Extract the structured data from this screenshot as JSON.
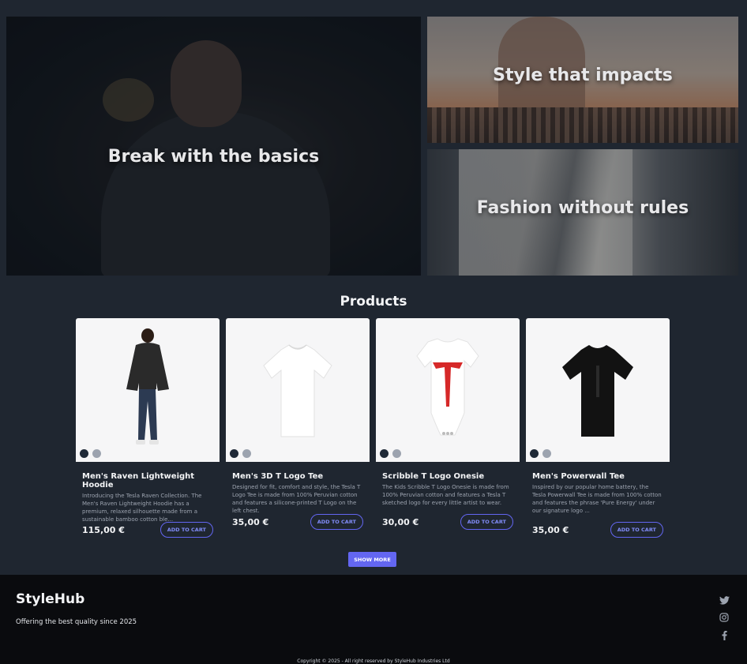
{
  "hero": {
    "main_title": "Break with the basics",
    "top_right_title": "Style that impacts",
    "bottom_right_title": "Fashion without rules"
  },
  "products": {
    "title": "Products",
    "items": [
      {
        "name": "Men's Raven Lightweight Hoodie",
        "description": "Introducing the Tesla Raven Collection. The Men's Raven Lightweight Hoodie has a premium, relaxed silhouette made from a sustainable bamboo cotton ble...",
        "price": "115,00 €",
        "button": "ADD TO CART"
      },
      {
        "name": "Men's 3D T Logo Tee",
        "description": "Designed for fit, comfort and style, the Tesla T Logo Tee is made from 100% Peruvian cotton and features a silicone-printed T Logo on the left chest.",
        "price": "35,00 €",
        "button": "ADD TO CART"
      },
      {
        "name": "Scribble T Logo Onesie",
        "description": "The Kids Scribble T Logo Onesie is made from 100% Peruvian cotton and features a Tesla T sketched logo for every little artist to wear.",
        "price": "30,00 €",
        "button": "ADD TO CART"
      },
      {
        "name": "Men's Powerwall Tee",
        "description": "Inspired by our popular home battery, the Tesla Powerwall Tee is made from 100% cotton and features the phrase 'Pure Energy' under our signature logo ...",
        "price": "35,00 €",
        "button": "ADD TO CART"
      }
    ],
    "show_more": "SHOW MORE"
  },
  "footer": {
    "brand": "StyleHub",
    "tagline": "Offering the best quality since 2025",
    "copyright": "Copyright © 2025 - All right reserved by StyleHub Industries Ltd",
    "social": [
      "twitter-icon",
      "instagram-icon",
      "facebook-icon"
    ]
  },
  "colors": {
    "accent": "#6366f1",
    "background": "#1f2630",
    "footer": "#0a0b0e"
  }
}
